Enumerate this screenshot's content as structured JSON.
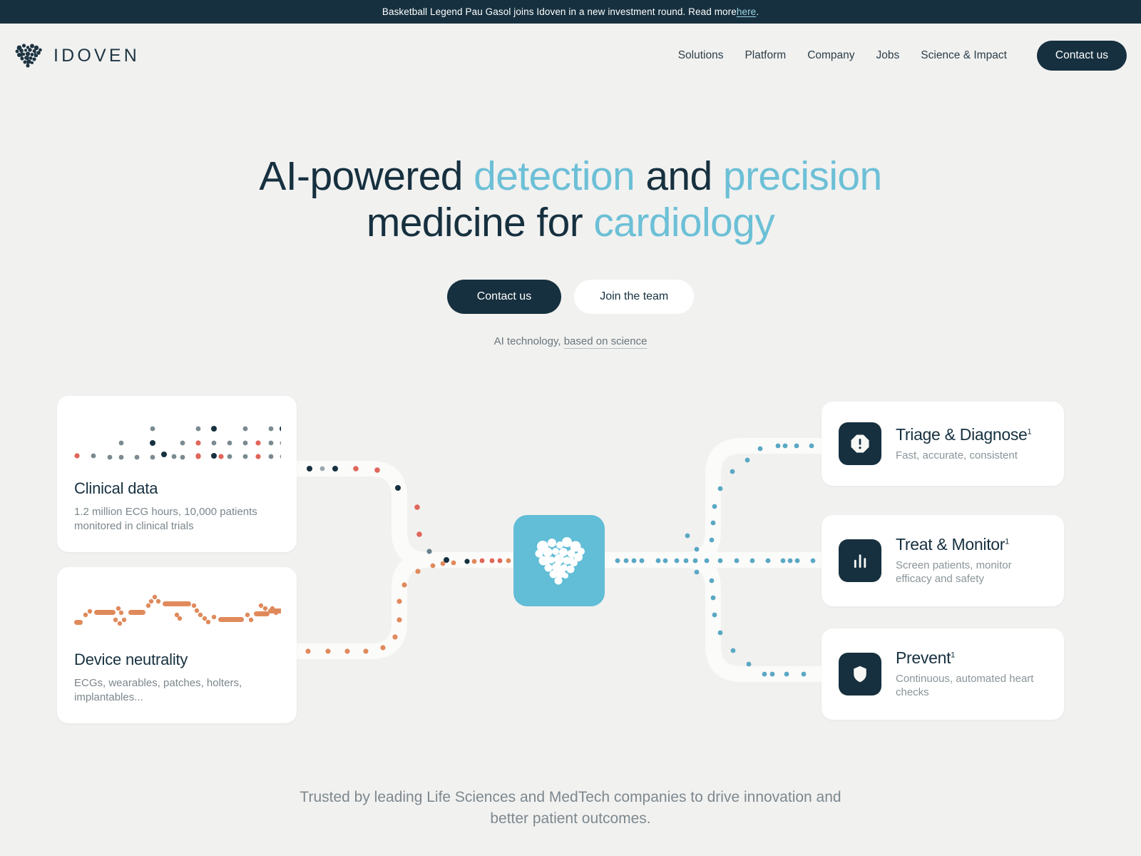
{
  "announcement": {
    "text_before": "Basketball Legend Pau Gasol joins Idoven in a new investment round. Read more ",
    "link_label": "here",
    "text_after": "."
  },
  "header": {
    "logo_text": "IDOVEN",
    "logo_icon": "heart-dots-logo",
    "nav": [
      {
        "label": "Solutions"
      },
      {
        "label": "Platform"
      },
      {
        "label": "Company"
      },
      {
        "label": "Jobs"
      },
      {
        "label": "Science & Impact"
      }
    ],
    "cta_label": "Contact us"
  },
  "hero": {
    "line1_part1": "AI-powered ",
    "line1_highlight1": "detection",
    "line1_part2": " and ",
    "line1_highlight2": "precision",
    "line2_part1": "medicine for ",
    "line2_highlight": "cardiology",
    "primary_button": "Contact us",
    "secondary_button": "Join the team",
    "note_prefix": "AI technology, ",
    "note_link": "based on science"
  },
  "diagram": {
    "hub_icon": "idoven-heart-icon",
    "input_cards": [
      {
        "id": "clinical",
        "viz": "scatter-dot-grid",
        "title": "Clinical data",
        "desc": "1.2 million ECG hours, 10,000 patients monitored in clinical trials"
      },
      {
        "id": "device",
        "viz": "ecg-dashed-waveform",
        "title": "Device neutrality",
        "desc": "ECGs, wearables, patches, holters, implantables..."
      }
    ],
    "output_cards": [
      {
        "id": "triage",
        "icon": "alert-octagon-icon",
        "title": "Triage & Diagnose",
        "sup": "1",
        "desc": "Fast, accurate, consistent"
      },
      {
        "id": "treat",
        "icon": "bar-chart-icon",
        "title": "Treat & Monitor",
        "sup": "1",
        "desc": "Screen patients, monitor efficacy and safety"
      },
      {
        "id": "prevent",
        "icon": "shield-icon",
        "title": "Prevent",
        "sup": "1",
        "desc": "Continuous, automated heart checks"
      }
    ]
  },
  "trusted": {
    "line1": "Trusted by leading Life Sciences and MedTech companies to drive innovation and",
    "line2": "better patient outcomes."
  },
  "colors": {
    "page_bg": "#f1f1f0",
    "navy": "#16303f",
    "accent_blue": "#6cc0d6",
    "hub_blue": "#62bdd6",
    "orange": "#e08a5c",
    "red": "#e0655a",
    "grey_dot": "#7a8a90",
    "card_white": "#ffffff",
    "muted_text": "#7b868c"
  }
}
